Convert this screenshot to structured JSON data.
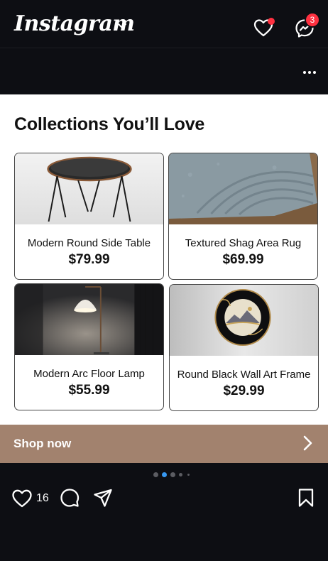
{
  "topbar": {
    "brand": "Instagram",
    "messages_badge": "3"
  },
  "post": {
    "heading": "Collections You’ll Love",
    "products": [
      {
        "name": "Modern Round Side Table",
        "price": "$79.99"
      },
      {
        "name": "Textured Shag Area Rug",
        "price": "$69.99"
      },
      {
        "name": "Modern Arc Floor Lamp",
        "price": "$55.99"
      },
      {
        "name": "Round Black Wall Art Frame",
        "price": "$29.99"
      }
    ],
    "cta": "Shop now",
    "carousel": {
      "count": 5,
      "active": 2
    }
  },
  "actions": {
    "like_count": "16"
  },
  "colors": {
    "background": "#0d0e13",
    "card_area": "#ffffff",
    "cta_bar": "#a2826e",
    "notification": "#ff3040",
    "carousel_active": "#3797f0"
  },
  "icons": [
    "chevron-down-icon",
    "heart-icon",
    "messenger-icon",
    "more-icon",
    "chevron-right-icon",
    "like-icon",
    "comment-icon",
    "share-icon",
    "bookmark-icon"
  ]
}
